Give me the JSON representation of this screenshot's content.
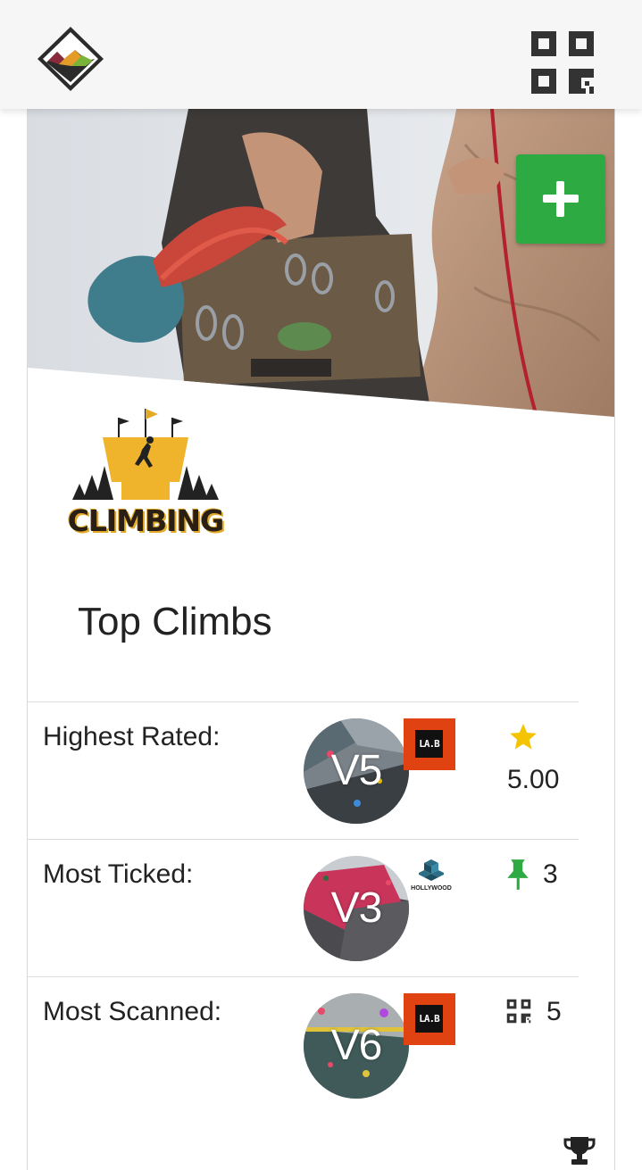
{
  "header": {
    "logo_icon": "mountain-logo-icon",
    "qr_icon": "qr-code-icon"
  },
  "hero": {
    "image": "climber-with-gear-photo",
    "add_icon": "plus-icon",
    "add_color": "#2eaa43"
  },
  "gym_logo": {
    "text": "CLIMBING"
  },
  "section": {
    "title": "Top Climbs"
  },
  "top_climbs": [
    {
      "label": "Highest Rated:",
      "grade": "V5",
      "gym_badge": "LA.B",
      "stat_icon": "star-icon",
      "stat_value": "5.00"
    },
    {
      "label": "Most Ticked:",
      "grade": "V3",
      "gym_badge": "HOLLYWOOD",
      "stat_icon": "pin-icon",
      "stat_value": "3"
    },
    {
      "label": "Most Scanned:",
      "grade": "V6",
      "gym_badge": "LA.B",
      "stat_icon": "qr-code-icon",
      "stat_value": "5"
    }
  ],
  "footer": {
    "trophy_icon": "trophy-icon"
  },
  "colors": {
    "accent_green": "#2eaa43",
    "star_yellow": "#f5c400",
    "badge_orange": "#e04212"
  }
}
